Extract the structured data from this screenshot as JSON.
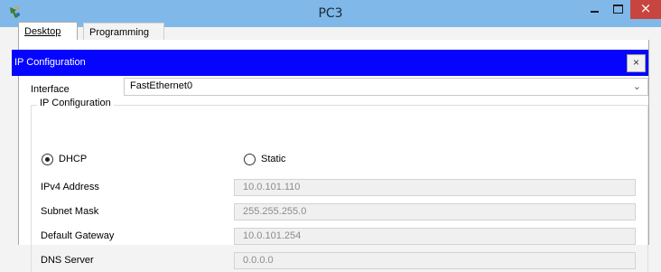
{
  "window": {
    "title": "PC3",
    "close_glyph": "×",
    "icon": "packet-tracer-icon"
  },
  "tabs": [
    {
      "label": "Desktop"
    },
    {
      "label": "Programming"
    }
  ],
  "ip_config": {
    "header_title": "IP Configuration",
    "close_glyph": "×",
    "interface_label": "Interface",
    "interface_value": "FastEthernet0",
    "group_title": "IP Configuration",
    "dhcp_label": "DHCP",
    "static_label": "Static",
    "selected_mode": "DHCP",
    "fields": [
      {
        "label": "IPv4 Address",
        "value": "10.0.101.110"
      },
      {
        "label": "Subnet Mask",
        "value": "255.255.255.0"
      },
      {
        "label": "Default Gateway",
        "value": "10.0.101.254"
      },
      {
        "label": "DNS Server",
        "value": "0.0.0.0"
      }
    ]
  },
  "colors": {
    "titlebar": "#7fb8e9",
    "header": "#0505ff",
    "close_button": "#c7453e"
  }
}
